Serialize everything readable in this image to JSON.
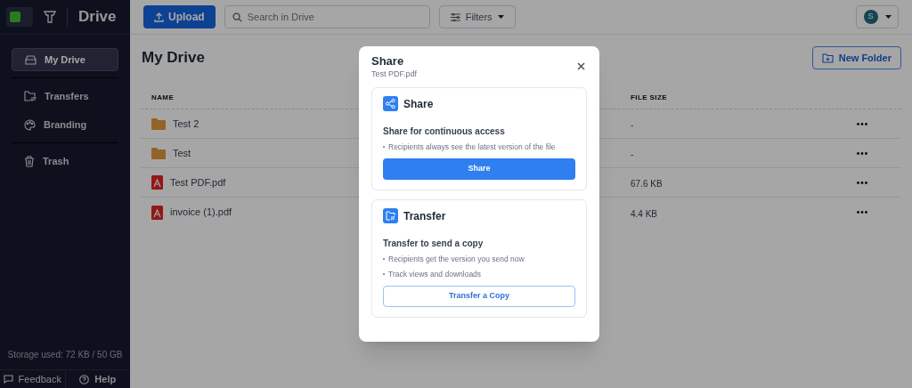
{
  "app": {
    "title": "Drive"
  },
  "sidebar": {
    "items": [
      {
        "label": "My Drive",
        "kind": "drive",
        "selected": true
      },
      {
        "label": "Transfers",
        "kind": "transfers",
        "selected": false
      },
      {
        "label": "Branding",
        "kind": "palette",
        "selected": false
      },
      {
        "label": "Trash",
        "kind": "trash",
        "selected": false
      }
    ],
    "storage": "Storage used: 72 KB / 50 GB",
    "footer": [
      "Feedback",
      "Help"
    ]
  },
  "toolbar": {
    "upload": "Upload",
    "search_placeholder": "Search in Drive",
    "filters": "Filters",
    "avatar": "S"
  },
  "page": {
    "title": "My Drive",
    "new_folder": "New Folder"
  },
  "table": {
    "columns": [
      "NAME",
      "FILE SIZE"
    ],
    "rows": [
      {
        "kind": "folder",
        "name": "Test 2",
        "size": "-"
      },
      {
        "kind": "folder",
        "name": "Test",
        "size": "-"
      },
      {
        "kind": "pdf",
        "name": "Test PDF.pdf",
        "size": "67.6 KB"
      },
      {
        "kind": "pdf",
        "name": "invoice (1).pdf",
        "size": "4.4 KB"
      }
    ]
  },
  "dialog": {
    "title": "Share",
    "subtitle": "Test PDF.pdf",
    "options": [
      {
        "kind": "share",
        "title": "Share",
        "heading": "Share for continuous access",
        "bullets": [
          "Recipients always see the latest version of the file"
        ],
        "button": "Share"
      },
      {
        "kind": "transfer",
        "title": "Transfer",
        "heading": "Transfer to send a copy",
        "bullets": [
          "Recipients get the version you send now",
          "Track views and downloads"
        ],
        "button": "Transfer a Copy"
      }
    ]
  }
}
